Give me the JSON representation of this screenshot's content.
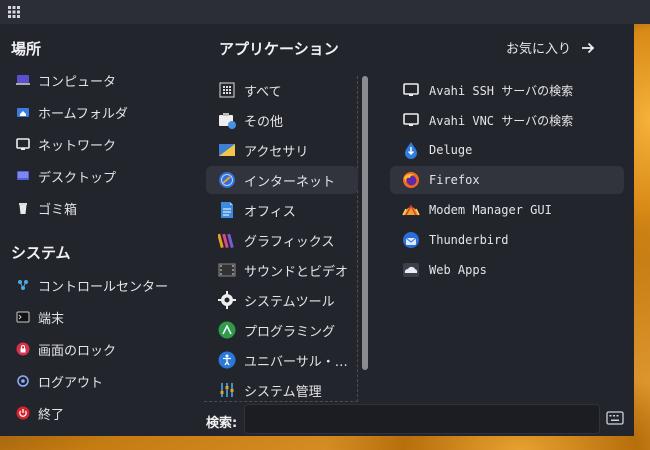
{
  "places": {
    "title": "場所",
    "items": [
      {
        "label": "コンピュータ",
        "icon": "computer-icon"
      },
      {
        "label": "ホームフォルダ",
        "icon": "home-folder-icon"
      },
      {
        "label": "ネットワーク",
        "icon": "network-icon"
      },
      {
        "label": "デスクトップ",
        "icon": "desktop-icon"
      },
      {
        "label": "ゴミ箱",
        "icon": "trash-icon"
      }
    ]
  },
  "system": {
    "title": "システム",
    "items": [
      {
        "label": "コントロールセンター",
        "icon": "control-center-icon"
      },
      {
        "label": "端末",
        "icon": "terminal-icon"
      },
      {
        "label": "画面のロック",
        "icon": "lock-icon"
      },
      {
        "label": "ログアウト",
        "icon": "logout-icon"
      },
      {
        "label": "終了",
        "icon": "power-icon"
      }
    ]
  },
  "applications": {
    "title": "アプリケーション",
    "favorites_label": "お気に入り",
    "categories": [
      {
        "label": "すべて",
        "icon": "all-apps-icon"
      },
      {
        "label": "その他",
        "icon": "other-icon"
      },
      {
        "label": "アクセサリ",
        "icon": "accessories-icon"
      },
      {
        "label": "インターネット",
        "icon": "internet-icon",
        "selected": true
      },
      {
        "label": "オフィス",
        "icon": "office-icon"
      },
      {
        "label": "グラフィックス",
        "icon": "graphics-icon"
      },
      {
        "label": "サウンドとビデオ",
        "icon": "sound-video-icon"
      },
      {
        "label": "システムツール",
        "icon": "system-tools-icon"
      },
      {
        "label": "プログラミング",
        "icon": "programming-icon"
      },
      {
        "label": "ユニバーサル・…",
        "icon": "universal-access-icon"
      },
      {
        "label": "システム管理",
        "icon": "administration-icon"
      }
    ],
    "apps": [
      {
        "label": "Avahi SSH サーバの検索",
        "icon": "monitor-icon"
      },
      {
        "label": "Avahi VNC サーバの検索",
        "icon": "monitor-icon"
      },
      {
        "label": "Deluge",
        "icon": "deluge-icon"
      },
      {
        "label": "Firefox",
        "icon": "firefox-icon",
        "selected": true
      },
      {
        "label": "Modem Manager GUI",
        "icon": "modem-manager-icon"
      },
      {
        "label": "Thunderbird",
        "icon": "thunderbird-icon"
      },
      {
        "label": "Web Apps",
        "icon": "web-apps-icon"
      }
    ]
  },
  "search": {
    "label": "検索:",
    "value": "",
    "placeholder": ""
  }
}
